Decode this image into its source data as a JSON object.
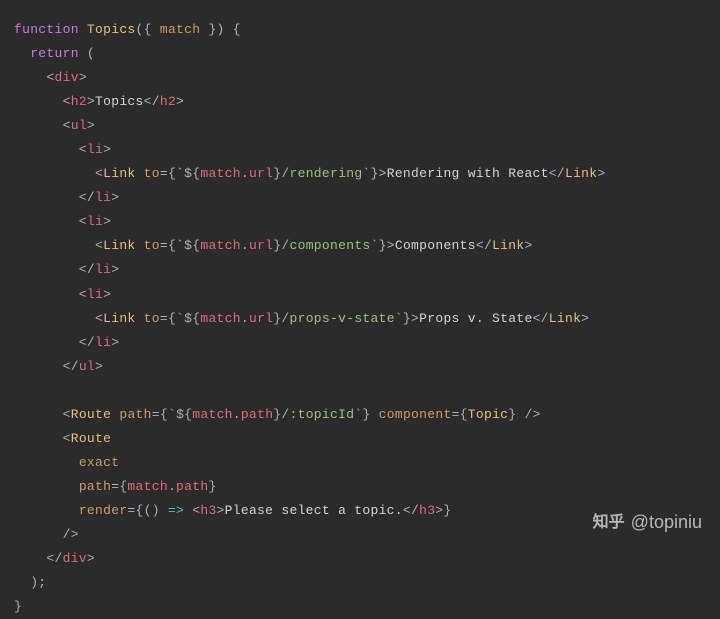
{
  "code": {
    "l1_kw1": "function",
    "l1_fn": "Topics",
    "l1_rest": "({ ",
    "l1_param": "match",
    "l1_rest2": " }) {",
    "l2_kw": "return",
    "l2_rest": " (",
    "l3": "    <",
    "l3_tag": "div",
    "l3_close": ">",
    "l4_open": "      <",
    "l4_tag": "h2",
    "l4_mid": ">",
    "l4_text": "Topics",
    "l4_close": "</",
    "l4_tag2": "h2",
    "l4_end": ">",
    "l5_open": "      <",
    "l5_tag": "ul",
    "l5_close": ">",
    "l6_open": "        <",
    "l6_tag": "li",
    "l6_close": ">",
    "l7_open": "          <",
    "l7_tag": "Link",
    "l7_sp": " ",
    "l7_attr": "to",
    "l7_eq": "={`",
    "l7_int1": "${",
    "l7_var": "match",
    "l7_dot": ".",
    "l7_prop": "url",
    "l7_int2": "}",
    "l7_str": "/rendering",
    "l7_eq2": "`}>",
    "l7_text": "Rendering with React",
    "l7_close": "</",
    "l7_tag2": "Link",
    "l7_end": ">",
    "l8_open": "        </",
    "l8_tag": "li",
    "l8_close": ">",
    "l9_open": "        <",
    "l9_tag": "li",
    "l9_close": ">",
    "l10_open": "          <",
    "l10_tag": "Link",
    "l10_sp": " ",
    "l10_attr": "to",
    "l10_eq": "={`",
    "l10_int1": "${",
    "l10_var": "match",
    "l10_dot": ".",
    "l10_prop": "url",
    "l10_int2": "}",
    "l10_str": "/components",
    "l10_eq2": "`}>",
    "l10_text": "Components",
    "l10_close": "</",
    "l10_tag2": "Link",
    "l10_end": ">",
    "l11_open": "        </",
    "l11_tag": "li",
    "l11_close": ">",
    "l12_open": "        <",
    "l12_tag": "li",
    "l12_close": ">",
    "l13_open": "          <",
    "l13_tag": "Link",
    "l13_sp": " ",
    "l13_attr": "to",
    "l13_eq": "={`",
    "l13_int1": "${",
    "l13_var": "match",
    "l13_dot": ".",
    "l13_prop": "url",
    "l13_int2": "}",
    "l13_str": "/props-v-state",
    "l13_eq2": "`}>",
    "l13_text": "Props v. State",
    "l13_close": "</",
    "l13_tag2": "Link",
    "l13_end": ">",
    "l14_open": "        </",
    "l14_tag": "li",
    "l14_close": ">",
    "l15_open": "      </",
    "l15_tag": "ul",
    "l15_close": ">",
    "l17_open": "      <",
    "l17_tag": "Route",
    "l17_sp": " ",
    "l17_attr": "path",
    "l17_eq": "={`",
    "l17_int1": "${",
    "l17_var": "match",
    "l17_dot": ".",
    "l17_prop": "path",
    "l17_int2": "}",
    "l17_str": "/:topicId",
    "l17_eq2": "`} ",
    "l17_attr2": "component",
    "l17_eq3": "={",
    "l17_comp": "Topic",
    "l17_end": "} />",
    "l18_open": "      <",
    "l18_tag": "Route",
    "l19_pad": "        ",
    "l19_attr": "exact",
    "l20_pad": "        ",
    "l20_attr": "path",
    "l20_eq": "={",
    "l20_var": "match",
    "l20_dot": ".",
    "l20_prop": "path",
    "l20_end": "}",
    "l21_pad": "        ",
    "l21_attr": "render",
    "l21_eq": "={() ",
    "l21_arrow": "=>",
    "l21_sp": " <",
    "l21_tag": "h3",
    "l21_mid": ">",
    "l21_text": "Please select a topic.",
    "l21_close": "</",
    "l21_tag2": "h3",
    "l21_end": ">}",
    "l22": "      />",
    "l23_open": "    </",
    "l23_tag": "div",
    "l23_close": ">",
    "l24": "  );",
    "l25": "}"
  },
  "watermark": {
    "logo": "知乎",
    "text": "@topiniu"
  }
}
